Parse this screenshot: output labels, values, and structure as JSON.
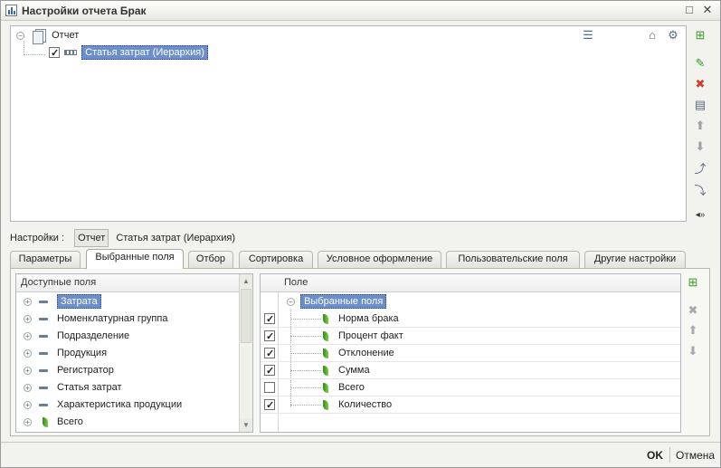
{
  "window": {
    "title": "Настройки отчета  Брак",
    "controls": [
      "□",
      "✕"
    ]
  },
  "structure_tree": {
    "root_label": "Отчет",
    "child_label": "Статья затрат (Иерархия)",
    "child_checked": true
  },
  "settings_bar": {
    "label": "Настройки :",
    "button_label": "Отчет",
    "path_text": "Статья затрат (Иерархия)"
  },
  "tabs": [
    {
      "label": "Параметры",
      "active": false
    },
    {
      "label": "Выбранные поля",
      "active": true
    },
    {
      "label": "Отбор",
      "active": false
    },
    {
      "label": "Сортировка",
      "active": false
    },
    {
      "label": "Условное оформление",
      "active": false
    },
    {
      "label": "Пользовательские поля",
      "active": false
    },
    {
      "label": "Другие настройки",
      "active": false
    }
  ],
  "available_fields": {
    "header": "Доступные поля",
    "items": [
      {
        "label": "Затрата",
        "selected": true,
        "icon": "minus-icon"
      },
      {
        "label": "Номенклатурная группа",
        "selected": false,
        "icon": "minus-icon"
      },
      {
        "label": "Подразделение",
        "selected": false,
        "icon": "minus-icon"
      },
      {
        "label": "Продукция",
        "selected": false,
        "icon": "minus-icon"
      },
      {
        "label": "Регистратор",
        "selected": false,
        "icon": "minus-icon"
      },
      {
        "label": "Статья затрат",
        "selected": false,
        "icon": "minus-icon"
      },
      {
        "label": "Характеристика продукции",
        "selected": false,
        "icon": "minus-icon"
      },
      {
        "label": "Всего",
        "selected": false,
        "icon": "attribute-icon"
      }
    ]
  },
  "selected_fields": {
    "header": "Поле",
    "group_label": "Выбранные поля",
    "items": [
      {
        "label": "Норма брака",
        "checked": true
      },
      {
        "label": "Процент факт",
        "checked": true
      },
      {
        "label": "Отклонение",
        "checked": true
      },
      {
        "label": "Сумма",
        "checked": true
      },
      {
        "label": "Всего",
        "checked": false
      },
      {
        "label": "Количество",
        "checked": true
      }
    ]
  },
  "footer": {
    "ok_label": "OK",
    "cancel_label": "Отмена"
  },
  "colors": {
    "selection": "#6d8fc9",
    "add_green": "#3a9a2a",
    "delete_red": "#d23a2a"
  }
}
